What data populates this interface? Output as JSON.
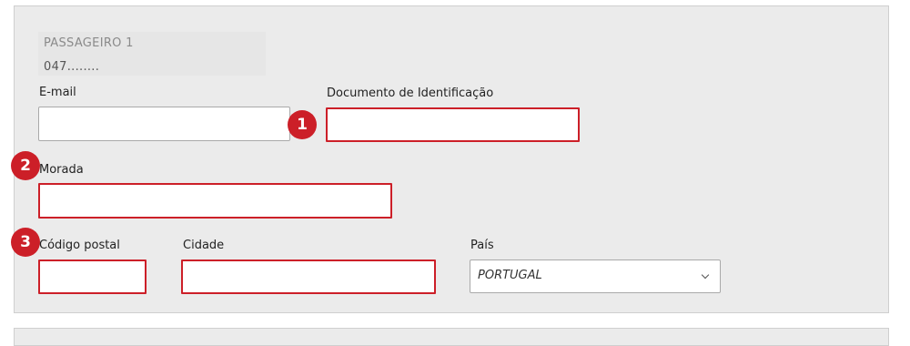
{
  "passenger": {
    "title": "PASSAGEIRO 1",
    "id": "047........"
  },
  "form": {
    "email": {
      "label": "E-mail",
      "value": ""
    },
    "document": {
      "label": "Documento de Identificação",
      "value": ""
    },
    "address": {
      "label": "Morada",
      "value": ""
    },
    "postal_code": {
      "label": "Código postal",
      "value": ""
    },
    "city": {
      "label": "Cidade",
      "value": ""
    },
    "country": {
      "label": "País",
      "selected": "PORTUGAL"
    }
  },
  "annotations": {
    "badge_1": "1",
    "badge_2": "2",
    "badge_3": "3",
    "color": "#cc1f28"
  },
  "colors": {
    "panel_background": "#ebebeb",
    "error_border": "#cc1f28",
    "input_border": "#a9a9a9"
  }
}
